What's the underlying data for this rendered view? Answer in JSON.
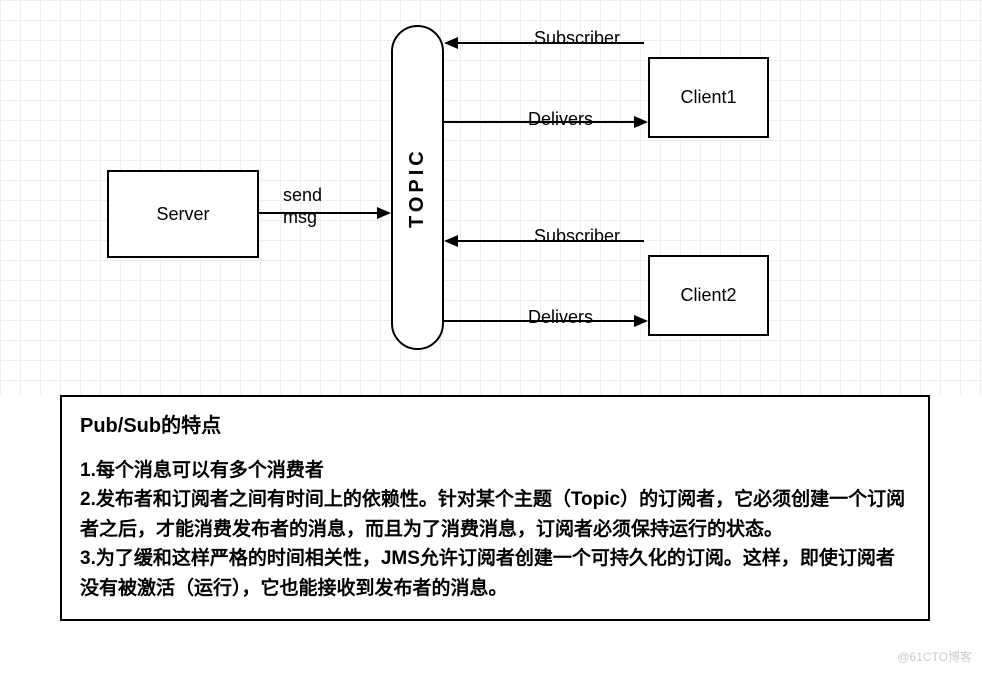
{
  "diagram": {
    "server": "Server",
    "topic": "TOPIC",
    "client1": "Client1",
    "client2": "Client2",
    "send_msg": "send\nmsg",
    "subscriber1": "Subscriber",
    "delivers1": "Delivers",
    "subscriber2": "Subscriber",
    "delivers2": "Delivers"
  },
  "desc": {
    "title": "Pub/Sub的特点",
    "item1": "1.每个消息可以有多个消费者",
    "item2": "2.发布者和订阅者之间有时间上的依赖性。针对某个主题（Topic）的订阅者，它必须创建一个订阅者之后，才能消费发布者的消息，而且为了消费消息，订阅者必须保持运行的状态。",
    "item3": "3.为了缓和这样严格的时间相关性，JMS允许订阅者创建一个可持久化的订阅。这样，即使订阅者没有被激活（运行），它也能接收到发布者的消息。"
  },
  "watermark": "@61CTO博客"
}
